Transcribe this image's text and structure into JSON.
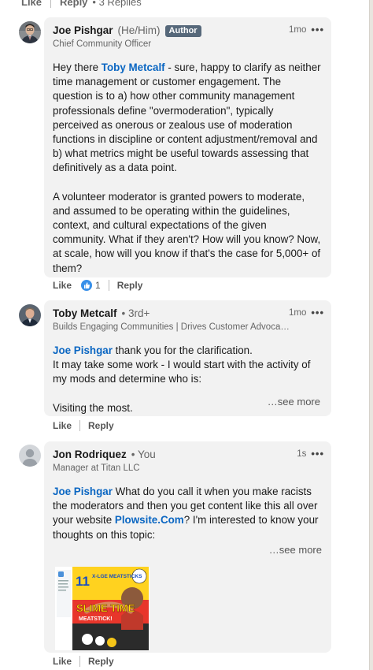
{
  "top_actions": {
    "like": "Like",
    "reply": "Reply",
    "replies": "3 Replies"
  },
  "comments": [
    {
      "name": "Joe Pishgar",
      "pronouns": "(He/Him)",
      "badge": "Author",
      "headline": "Chief Community Officer",
      "time": "1mo",
      "paragraph1": {
        "pre": "Hey there ",
        "mention": "Toby Metcalf",
        "post": " - sure, happy to clarify as neither time management or customer engagement. The question is to a) how other community management professionals define \"overmoderation\", typically perceived as onerous or zealous use of moderation functions in discipline or content adjustment/removal and b) what metrics might be useful towards assessing that definitively as a data point."
      },
      "paragraph2": "A volunteer moderator is granted powers to moderate, and assumed to be operating within the guidelines, context, and cultural expectations of the given community. What if they aren't? How will you know? Now, at scale, how will you know if that's the case for 5,000+ of them?",
      "like": "Like",
      "reaction_count": "1",
      "reply": "Reply"
    },
    {
      "name": "Toby Metcalf",
      "degree": "• 3rd+",
      "headline": "Builds Engaging Communities | Drives Customer Advoca…",
      "time": "1mo",
      "mention": "Joe Pishgar",
      "line1": " thank you for the clarification.",
      "line2": "It may take some work - I would start with the activity of my mods and determine who is:",
      "line3": "Visiting the most.",
      "see_more": "…see more",
      "like": "Like",
      "reply": "Reply"
    },
    {
      "name": "Jon Rodriquez",
      "degree": "• You",
      "headline": "Manager at Titan LLC",
      "time": "1s",
      "mention": "Joe Pishgar",
      "text1": " What do you call it when you make racists the moderators and then you get content like this all over your website ",
      "link": "Plowsite.Com",
      "text2": "? I'm interested to know your thoughts on this topic:",
      "see_more": "…see more",
      "attachment": {
        "title_a": "11",
        "title_b": "X-LGE MEATSTICKS",
        "banner": "SLIME TIME",
        "subbanner": "MEATSTICK!"
      },
      "like": "Like",
      "reply": "Reply"
    }
  ]
}
